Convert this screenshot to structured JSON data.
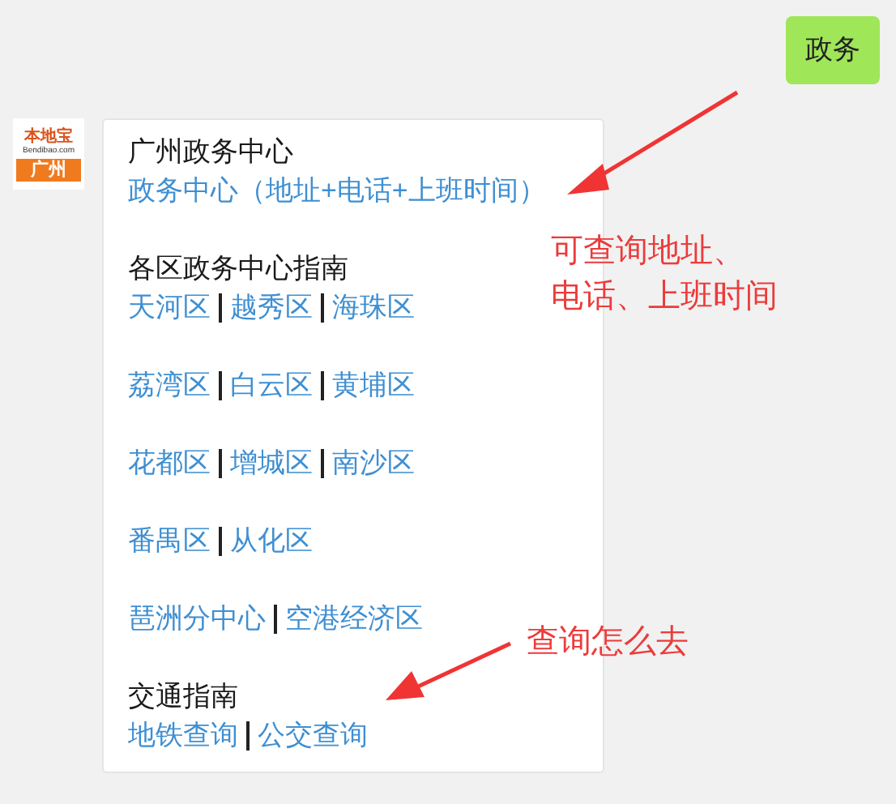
{
  "outgoing_message": {
    "text": "政务"
  },
  "avatar": {
    "logo": "本地宝",
    "site": "Bendibao.com",
    "city": "广州"
  },
  "reply_card": {
    "sections": [
      {
        "title": "广州政务中心",
        "lines": [
          [
            "政务中心（地址+电话+上班时间）"
          ]
        ]
      },
      {
        "title": "各区政务中心指南",
        "lines": [
          [
            "天河区",
            "越秀区",
            "海珠区"
          ],
          [
            "荔湾区",
            "白云区",
            "黄埔区"
          ],
          [
            "花都区",
            "增城区",
            "南沙区"
          ],
          [
            "番禺区",
            "从化区"
          ],
          [
            "琶洲分中心",
            "空港经济区"
          ]
        ]
      },
      {
        "title": "交通指南",
        "lines": [
          [
            "地铁查询",
            "公交查询"
          ]
        ]
      }
    ]
  },
  "annotations": [
    {
      "lines": [
        "可查询地址、",
        "电话、上班时间"
      ]
    },
    {
      "lines": [
        "查询怎么去"
      ]
    }
  ]
}
